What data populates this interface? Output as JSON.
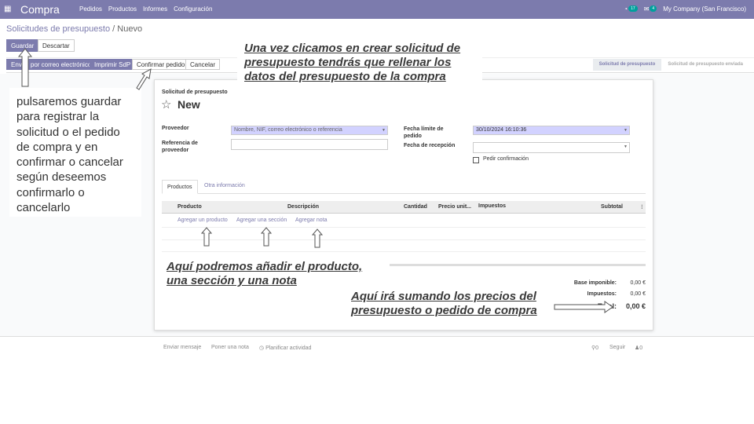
{
  "topbar": {
    "app_name": "Compra",
    "menu": [
      "Pedidos",
      "Productos",
      "Informes",
      "Configuración"
    ],
    "activity_count": "17",
    "message_count": "4",
    "company": "My Company (San Francisco)"
  },
  "breadcrumb": {
    "parent": "Solicitudes de presupuesto",
    "separator": "/",
    "current": "Nuevo"
  },
  "buttons": {
    "save": "Guardar",
    "discard": "Descartar",
    "send_email": "Enviar por correo electrónico",
    "print": "Imprimir SdP",
    "confirm": "Confirmar pedido",
    "cancel": "Cancelar"
  },
  "stages": {
    "active": "Solicitud de presupuesto",
    "next": "Solicitud de presupuesto enviada"
  },
  "form": {
    "subtitle": "Solicitud de presupuesto",
    "title": "New",
    "vendor_label": "Proveedor",
    "vendor_placeholder": "Nombre, NIF, correo electrónico o referencia",
    "vendor_ref_label": "Referencia de proveedor",
    "deadline_label": "Fecha límite de pedido",
    "deadline_value": "30/10/2024 16:10:36",
    "receipt_label": "Fecha de recepción",
    "ask_confirm_label": "Pedir confirmación"
  },
  "tabs": [
    "Productos",
    "Otra información"
  ],
  "table": {
    "headers": [
      "Producto",
      "Descripción",
      "Cantidad",
      "Precio unit...",
      "Impuestos",
      "Subtotal"
    ],
    "add_product": "Agregar un producto",
    "add_section": "Agregar una sección",
    "add_note": "Agregar nota"
  },
  "totals": {
    "base_label": "Base imponible:",
    "base_value": "0,00 €",
    "tax_label": "Impuestos:",
    "tax_value": "0,00 €",
    "total_label": "Total:",
    "total_value": "0,00 €"
  },
  "chatter": {
    "send_message": "Enviar mensaje",
    "log_note": "Poner una nota",
    "schedule": "Planificar actividad",
    "attachments": "0",
    "follow": "Seguir",
    "followers": "0"
  },
  "callouts": {
    "top": "Una vez clicamos en crear solicitud de presupuesto tendrás que rellenar los datos del presupuesto de la compra",
    "left": "pulsaremos guardar para registrar la solicitud o el pedido de compra y en confirmar o cancelar según deseemos confirmarlo o cancelarlo",
    "middle": "Aquí podremos añadir el producto, una sección y una nota",
    "bottom": "Aquí irá sumando los precios del presupuesto o pedido de compra"
  }
}
